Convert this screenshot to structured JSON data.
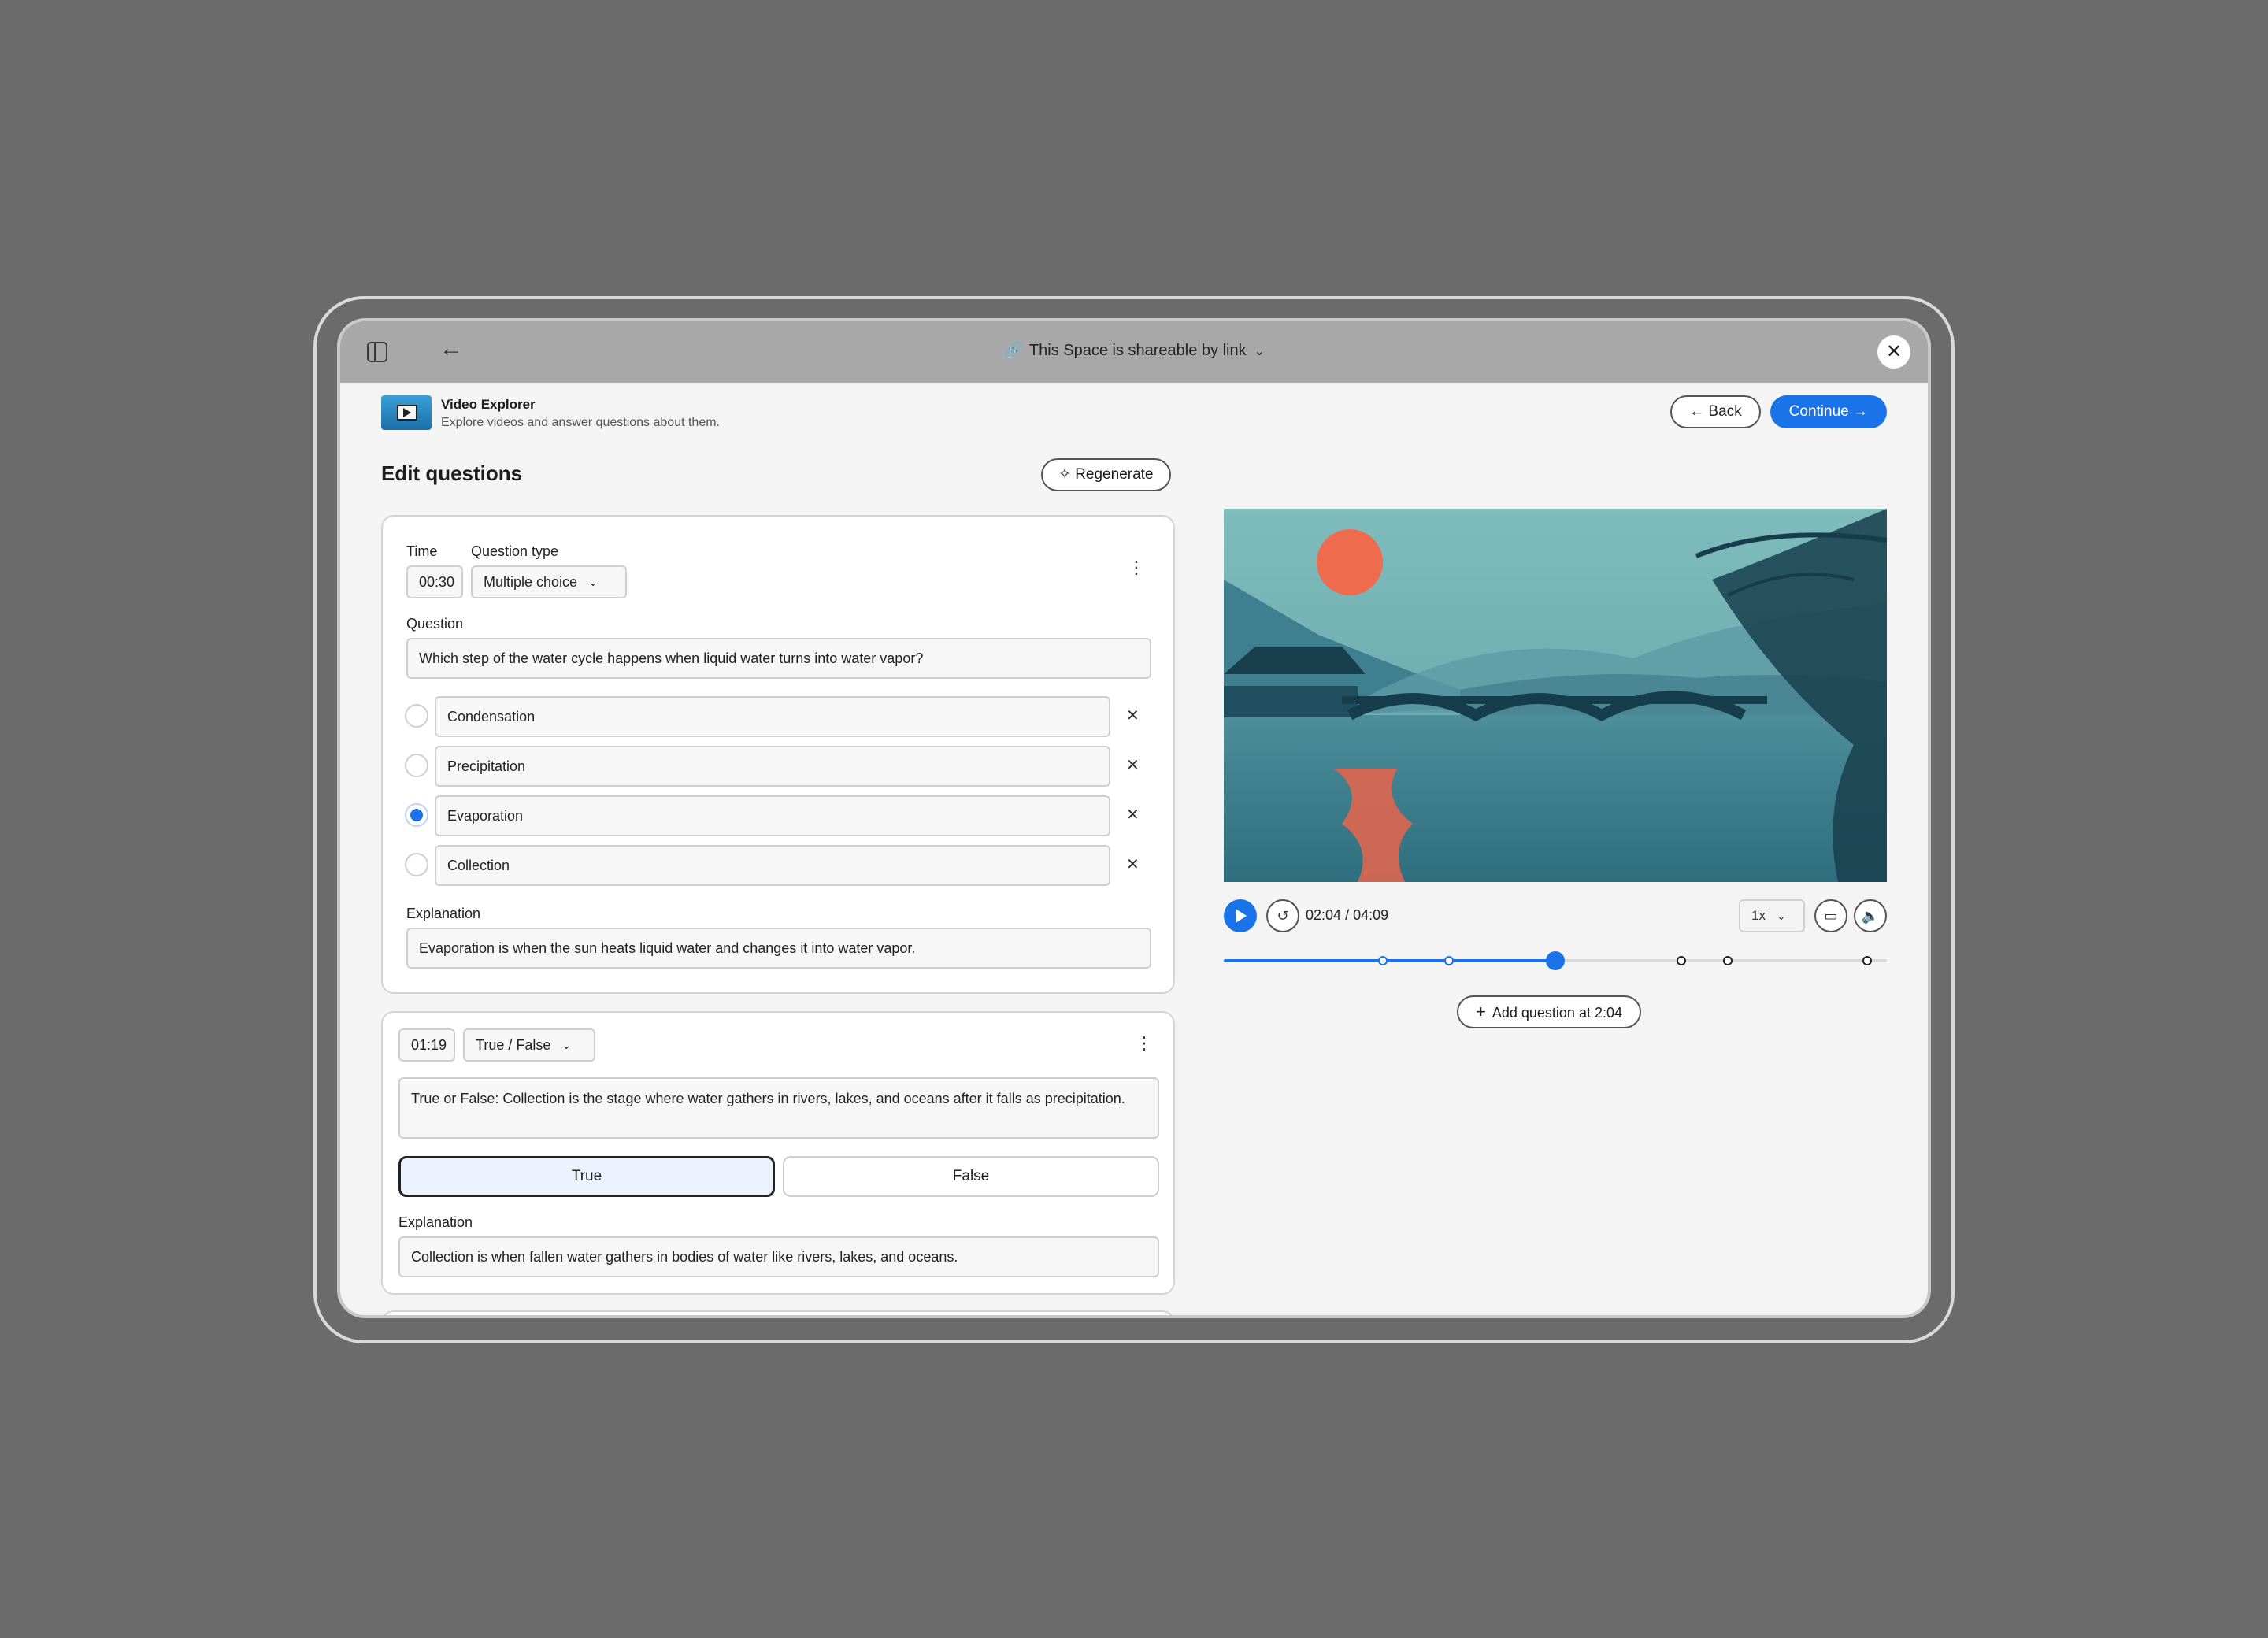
{
  "topbar": {
    "share_text": "This Space is shareable by link",
    "close_symbol": "✕"
  },
  "app": {
    "title": "Video Explorer",
    "subtitle": "Explore videos and answer questions about them.",
    "back_label": "Back",
    "continue_label": "Continue"
  },
  "page": {
    "title": "Edit questions",
    "regenerate_label": "Regenerate"
  },
  "q1": {
    "time_label": "Time",
    "type_label": "Question type",
    "time_value": "00:30",
    "type_value": "Multiple choice",
    "question_label": "Question",
    "question_text": "Which step of the water cycle happens when liquid water turns into water vapor?",
    "options": [
      {
        "text": "Condensation",
        "selected": false
      },
      {
        "text": "Precipitation",
        "selected": false
      },
      {
        "text": "Evaporation",
        "selected": true
      },
      {
        "text": "Collection",
        "selected": false
      }
    ],
    "explanation_label": "Explanation",
    "explanation_text": "Evaporation is when the sun heats liquid water and changes it into water vapor."
  },
  "q2": {
    "time_value": "01:19",
    "type_value": "True / False",
    "question_text": "True or False: Collection is the stage where water gathers in rivers, lakes, and oceans after it falls as precipitation.",
    "true_label": "True",
    "false_label": "False",
    "selected": "True",
    "explanation_label": "Explanation",
    "explanation_text": "Collection is when fallen water gathers in bodies of water like rivers, lakes, and oceans."
  },
  "player": {
    "current_time": "02:04",
    "duration": "/ 04:09",
    "speed": "1x",
    "progress": 0.5,
    "marker_positions": [
      0.24,
      0.34,
      0.69,
      0.76,
      0.97
    ],
    "add_question_label": "Add question at 2:04",
    "accent_color": "#1a73e8"
  }
}
